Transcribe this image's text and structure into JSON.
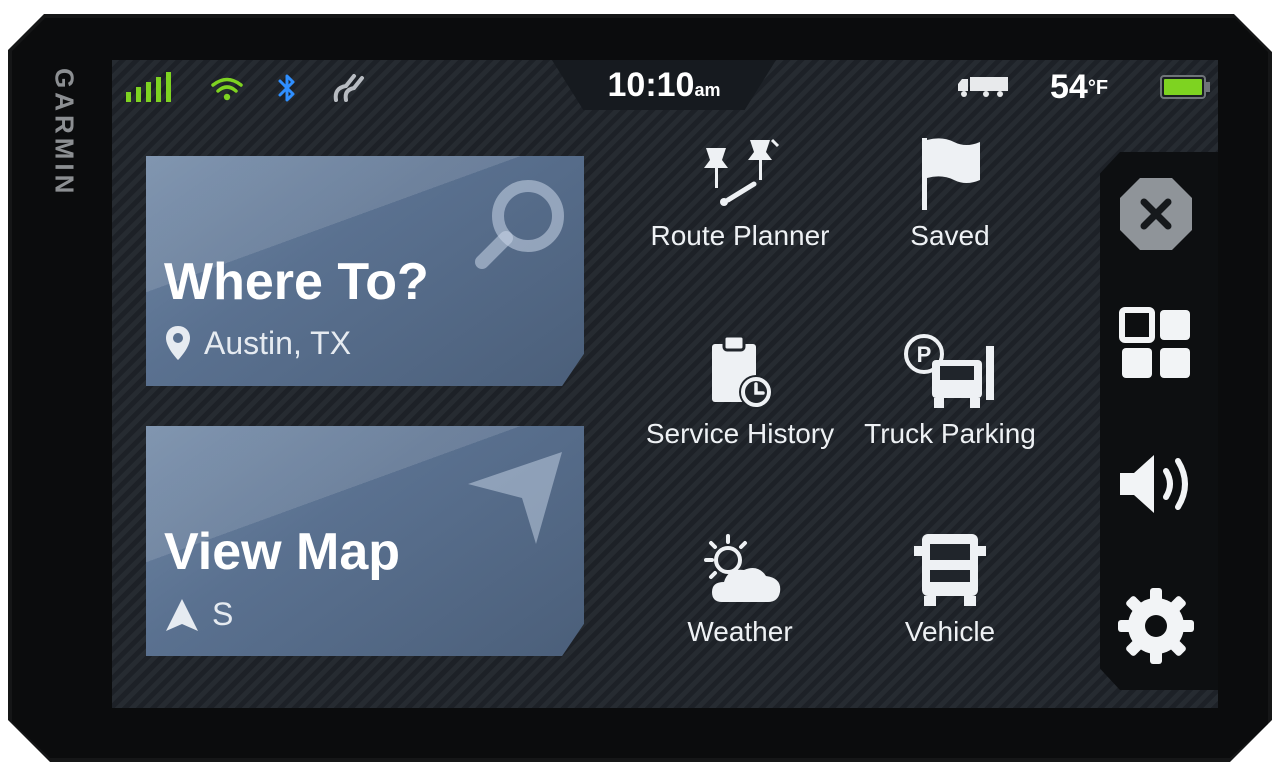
{
  "device": {
    "brand": "GARMIN"
  },
  "status_bar": {
    "time": "10:10",
    "time_suffix": "am",
    "temperature": "54",
    "temperature_unit": "°F",
    "colors": {
      "signal": "#7ed321",
      "wifi": "#7ed321",
      "bluetooth": "#2f8fff",
      "battery": "#7ed321"
    },
    "icons": [
      "signal-bars-icon",
      "wifi-icon",
      "bluetooth-icon",
      "drive-logo-icon",
      "truck-trailer-icon",
      "battery-icon"
    ]
  },
  "cards": {
    "where_to": {
      "title": "Where To?",
      "location": "Austin, TX",
      "icons": [
        "search-icon",
        "map-pin-icon"
      ]
    },
    "view_map": {
      "title": "View Map",
      "heading": "S",
      "icons": [
        "navigation-arrow-icon",
        "heading-arrow-icon"
      ]
    }
  },
  "menu": {
    "items": [
      {
        "label": "Route Planner",
        "icon": "route-planner-icon"
      },
      {
        "label": "Saved",
        "icon": "flag-icon"
      },
      {
        "label": "Service History",
        "icon": "clipboard-clock-icon"
      },
      {
        "label": "Truck Parking",
        "icon": "truck-parking-icon"
      },
      {
        "label": "Weather",
        "icon": "weather-icon"
      },
      {
        "label": "Vehicle",
        "icon": "truck-front-icon"
      }
    ]
  },
  "side_panel": {
    "icons": [
      "close-icon",
      "apps-grid-icon",
      "volume-icon",
      "settings-icon"
    ]
  }
}
